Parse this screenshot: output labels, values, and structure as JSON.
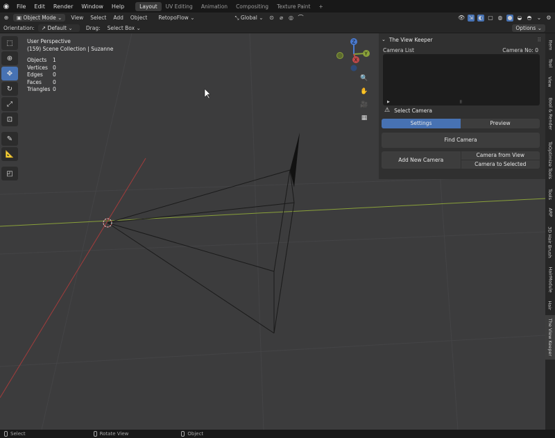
{
  "menubar": {
    "items": [
      "File",
      "Edit",
      "Render",
      "Window",
      "Help"
    ],
    "workspaces": [
      "Layout",
      "UV Editing",
      "Animation",
      "Compositing",
      "Texture Paint",
      "+"
    ],
    "active_workspace": "Layout"
  },
  "header": {
    "mode": "Object Mode",
    "menus": [
      "View",
      "Select",
      "Add",
      "Object"
    ],
    "addon_menu": "RetopoFlow",
    "transform_orientation": "Global"
  },
  "tool_settings": {
    "orientation_label": "Orientation:",
    "orientation_value": "Default",
    "drag_label": "Drag:",
    "drag_value": "Select Box",
    "options": "Options"
  },
  "viewport": {
    "perspective": "User Perspective",
    "collection": "(159) Scene Collection | Suzanne",
    "stats": [
      {
        "label": "Objects",
        "value": "1"
      },
      {
        "label": "Vertices",
        "value": "0"
      },
      {
        "label": "Edges",
        "value": "0"
      },
      {
        "label": "Faces",
        "value": "0"
      },
      {
        "label": "Triangles",
        "value": "0"
      }
    ],
    "gizmo_axes": [
      "Z",
      "Y",
      "X"
    ],
    "colors": {
      "x_axis": "#c24a4a",
      "y_axis": "#8aa13a",
      "background": "#3c3c3d"
    }
  },
  "panel": {
    "title": "The View Keeper",
    "list_label": "Camera List",
    "camera_no": "Camera No:  0",
    "warning": "Select Camera",
    "tabs": [
      "Settings",
      "Preview"
    ],
    "active_tab": "Settings",
    "find_camera": "Find Camera",
    "add_new_camera": "Add New Camera",
    "camera_from_view": "Camera from View",
    "camera_to_selected": "Camera to Selected"
  },
  "side_tabs": [
    "Item",
    "Tool",
    "View",
    "Bool & Render",
    "ToOptimize Tools",
    "Tools",
    "ARP",
    "3D Hair Brush",
    "HairModule",
    "Hair",
    "The View Keeper"
  ],
  "statusbar": {
    "select": "Select",
    "rotate": "Rotate View",
    "object": "Object"
  },
  "accent": "#4772b3"
}
